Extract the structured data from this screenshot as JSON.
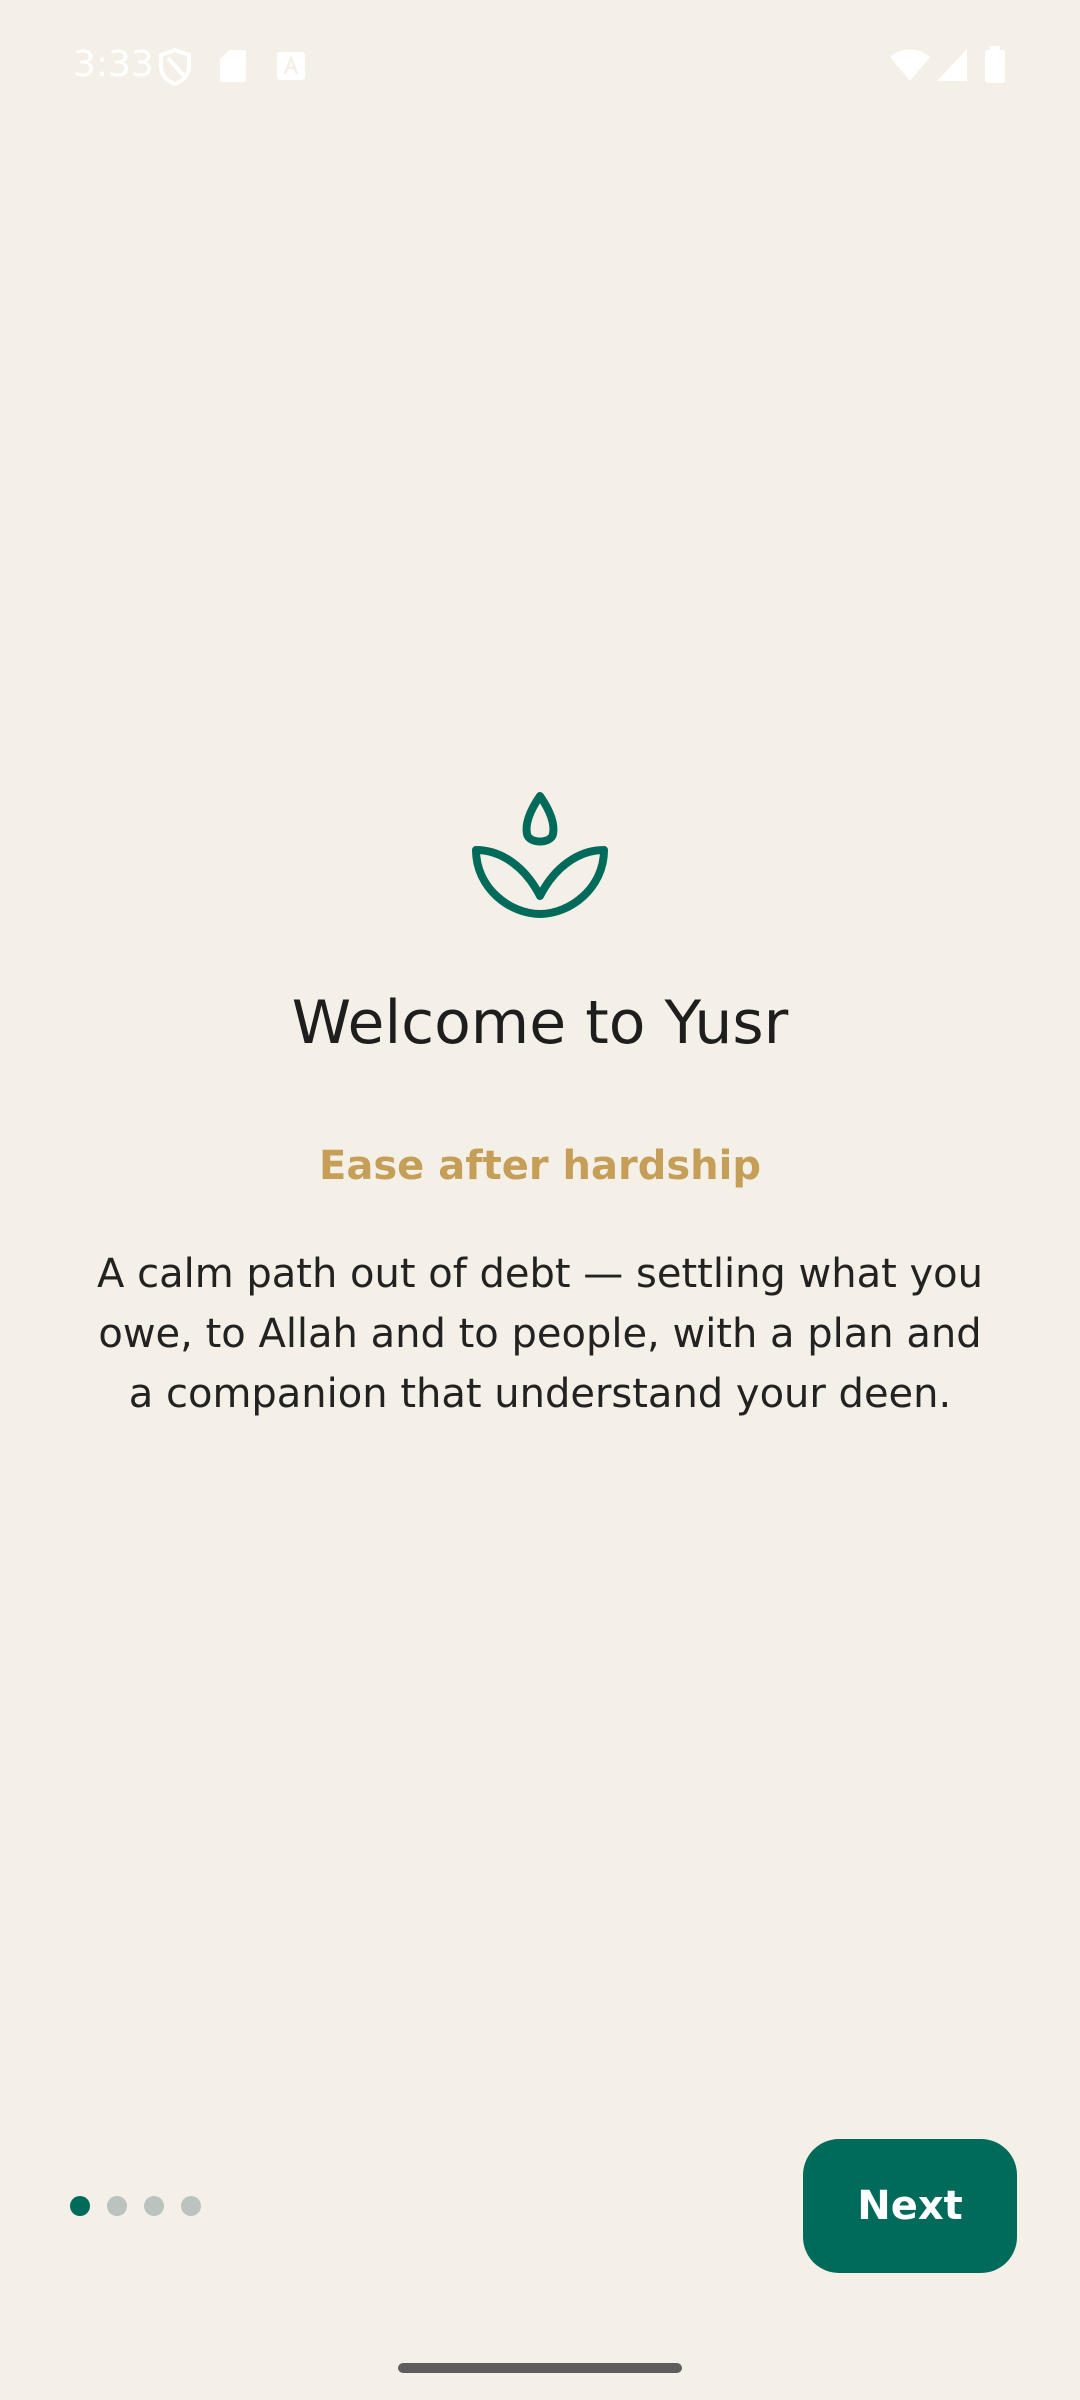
{
  "status_bar": {
    "time": "3:33",
    "left_icons": [
      "shield-icon",
      "sd-card-icon",
      "font-a-icon"
    ],
    "right_icons": [
      "wifi-icon",
      "signal-icon",
      "battery-icon"
    ]
  },
  "onboarding": {
    "logo_icon": "sprout-leaves-icon",
    "title": "Welcome to Yusr",
    "tagline": "Ease after hardship",
    "description": "A calm path out of debt — settling what you owe, to Allah and to people, with a plan and a companion that understand your deen."
  },
  "pager": {
    "total_pages": 4,
    "current_page": 1
  },
  "actions": {
    "next_label": "Next"
  },
  "colors": {
    "background": "#F4F0E7",
    "primary": "#006B5A",
    "accent": "#C59E58",
    "inactive_dot": "#BAC3BF",
    "text": "#1E1E1E"
  }
}
